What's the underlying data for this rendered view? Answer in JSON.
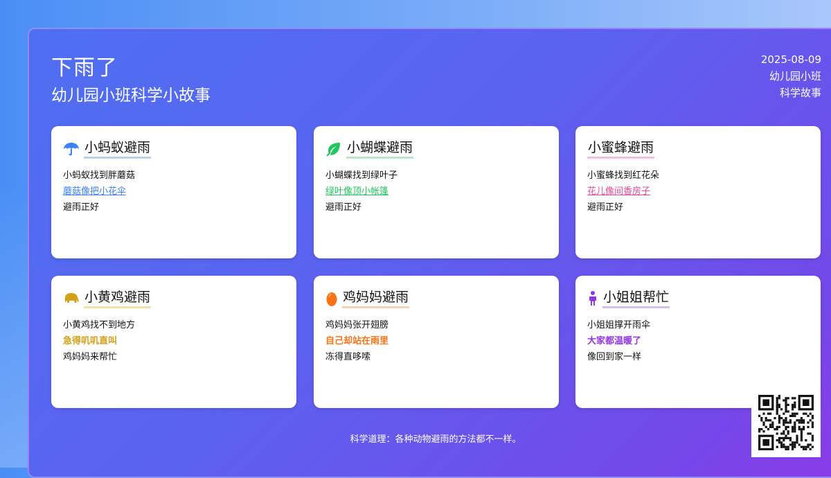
{
  "header": {
    "title": "下雨了",
    "subtitle": "幼儿园小班科学小故事",
    "date": "2025-08-09",
    "class": "幼儿园小班",
    "category": "科学故事"
  },
  "cards": [
    {
      "title": "小蚂蚁避雨",
      "icon": "umbrella-icon",
      "accent": "#3b82f6",
      "underline": "#b9d0f2",
      "lines": [
        "小蚂蚁找到胖蘑菇",
        "蘑菇像把小花伞",
        "避雨正好"
      ]
    },
    {
      "title": "小蝴蝶避雨",
      "icon": "leaf-icon",
      "accent": "#22c55e",
      "underline": "#b6e8c6",
      "lines": [
        "小蝴蝶找到绿叶子",
        "绿叶像顶小帐篷",
        "避雨正好"
      ]
    },
    {
      "title": "小蜜蜂避雨",
      "icon": "",
      "accent": "#ec4899",
      "underline": "#f4bfdc",
      "lines": [
        "小蜜蜂找到红花朵",
        "花儿像间香房子",
        "避雨正好"
      ]
    },
    {
      "title": "小黄鸡避雨",
      "icon": "elephant-icon",
      "accent": "#d4a017",
      "underline": "#f5e2a4",
      "lines": [
        "小黄鸡找不到地方",
        "急得叽叽直叫",
        "鸡妈妈来帮忙"
      ]
    },
    {
      "title": "鸡妈妈避雨",
      "icon": "egg-icon",
      "accent": "#f97316",
      "underline": "#f9d2b2",
      "lines": [
        "鸡妈妈张开翅膀",
        "自己却站在雨里",
        "冻得直哆嗦"
      ]
    },
    {
      "title": "小姐姐帮忙",
      "icon": "person-icon",
      "accent": "#9333ea",
      "underline": "#d7bdf2",
      "lines": [
        "小姐姐撑开雨伞",
        "大家都温暖了",
        "像回到家一样"
      ]
    }
  ],
  "footer": {
    "text": "科学道理：各种动物避雨的方法都不一样。"
  }
}
